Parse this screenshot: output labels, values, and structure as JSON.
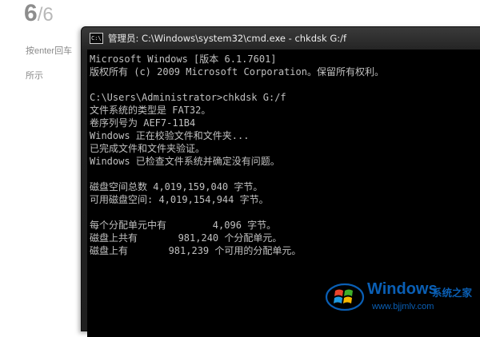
{
  "background": {
    "step_current": "6",
    "step_total": "/6",
    "instruction_line1": "按enter回车",
    "instruction_line2": "所示"
  },
  "window": {
    "title": "管理员: C:\\Windows\\system32\\cmd.exe - chkdsk  G:/f",
    "icon": "cmd-icon"
  },
  "console": {
    "lines": [
      "Microsoft Windows [版本 6.1.7601]",
      "版权所有 (c) 2009 Microsoft Corporation。保留所有权利。",
      "",
      "C:\\Users\\Administrator>chkdsk G:/f",
      "文件系统的类型是 FAT32。",
      "卷序列号为 AEF7-11B4",
      "Windows 正在校验文件和文件夹...",
      "已完成文件和文件夹验证。",
      "Windows 已检查文件系统并确定没有问题。",
      "",
      "磁盘空间总数 4,019,159,040 字节。",
      "可用磁盘空间: 4,019,154,944 字节。",
      "",
      "每个分配单元中有        4,096 字节。",
      "磁盘上共有       981,240 个分配单元。",
      "磁盘上有       981,239 个可用的分配单元。"
    ]
  },
  "watermark": {
    "brand": "Windows",
    "brand_cn": "系统之家",
    "url": "www.bjjmlv.com",
    "colors": {
      "blue": "#0a5fb5",
      "red": "#e8432b",
      "green": "#3fae2a",
      "sky": "#1e9ae0",
      "yellow": "#f6b800"
    }
  }
}
